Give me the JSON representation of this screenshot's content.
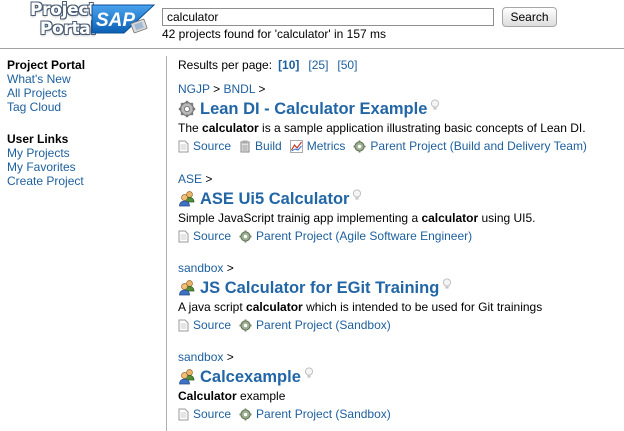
{
  "header": {
    "logo_line1": "Project",
    "logo_line2": "Portal",
    "sap_badge": "SAP",
    "search_value": "calculator",
    "search_button": "Search",
    "results_count": "42 projects found for 'calculator' in 157 ms"
  },
  "sidebar": {
    "section1_title": "Project Portal",
    "section1_links": [
      "What's New",
      "All Projects",
      "Tag Cloud"
    ],
    "section2_title": "User Links",
    "section2_links": [
      "My Projects",
      "My Favorites",
      "Create Project"
    ]
  },
  "main": {
    "per_page_label": "Results per page:",
    "per_page_options": [
      "[10]",
      "[25]",
      "[50]"
    ],
    "per_page_selected": "[10]",
    "results": [
      {
        "crumbs": [
          "NGJP",
          "BNDL"
        ],
        "title": "Lean DI - Calculator Example",
        "icon": "gear-icon",
        "desc_before": "The ",
        "desc_bold": "calculator",
        "desc_after": " is a sample application illustrating basic concepts of Lean DI.",
        "links": [
          {
            "label": "Source",
            "icon": "document-icon"
          },
          {
            "label": "Build",
            "icon": "build-icon"
          },
          {
            "label": "Metrics",
            "icon": "chart-icon"
          },
          {
            "label": "Parent Project (Build and Delivery Team)",
            "icon": "parent-gear-icon"
          }
        ]
      },
      {
        "crumbs": [
          "ASE"
        ],
        "title": "ASE Ui5 Calculator",
        "icon": "people-icon",
        "desc_before": "Simple JavaScript trainig app implementing a ",
        "desc_bold": "calculator",
        "desc_after": " using UI5.",
        "links": [
          {
            "label": "Source",
            "icon": "document-icon"
          },
          {
            "label": "Parent Project (Agile Software Engineer)",
            "icon": "parent-gear-icon"
          }
        ]
      },
      {
        "crumbs": [
          "sandbox"
        ],
        "title": "JS Calculator for EGit Training",
        "icon": "people-icon",
        "desc_before": "A java script ",
        "desc_bold": "calculator",
        "desc_after": " which is intended to be used for Git trainings",
        "links": [
          {
            "label": "Source",
            "icon": "document-icon"
          },
          {
            "label": "Parent Project (Sandbox)",
            "icon": "parent-gear-icon"
          }
        ]
      },
      {
        "crumbs": [
          "sandbox"
        ],
        "title": "Calcexample",
        "icon": "people-icon",
        "desc_before": "",
        "desc_bold": "Calculator",
        "desc_after": " example",
        "links": [
          {
            "label": "Source",
            "icon": "document-icon"
          },
          {
            "label": "Parent Project (Sandbox)",
            "icon": "parent-gear-icon"
          }
        ]
      }
    ]
  },
  "colors": {
    "link": "#1d5f9e",
    "title": "#2266a6",
    "sap_blue": "#1b6fc2"
  }
}
